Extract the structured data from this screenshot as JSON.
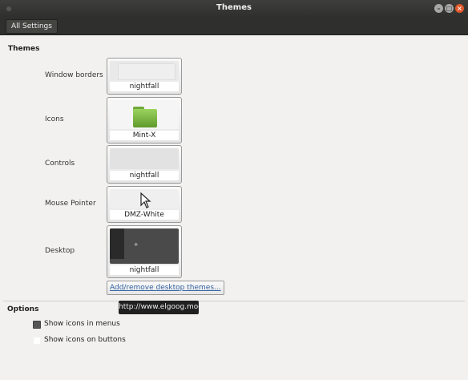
{
  "window": {
    "title": "Themes"
  },
  "toolbar": {
    "all_settings_label": "All Settings"
  },
  "themes_section": {
    "title": "Themes",
    "rows": [
      {
        "label": "Window borders",
        "value": "nightfall",
        "icon": "blank-preview"
      },
      {
        "label": "Icons",
        "value": "Mint-X",
        "icon": "folder-icon"
      },
      {
        "label": "Controls",
        "value": "nightfall",
        "icon": "blank-preview"
      },
      {
        "label": "Mouse Pointer",
        "value": "DMZ-White",
        "icon": "arrow-cursor-icon"
      },
      {
        "label": "Desktop",
        "value": "nightfall",
        "icon": "desktop-preview"
      }
    ],
    "add_remove_label": "Add/remove desktop themes..."
  },
  "tooltip": {
    "text": "http://www.elgoog.moc"
  },
  "options_section": {
    "title": "Options",
    "show_icons_in_menus": {
      "label": "Show icons in menus",
      "checked": true
    },
    "show_icons_on_buttons": {
      "label": "Show icons on buttons",
      "checked": false
    }
  },
  "colors": {
    "titlebar": "#2f2f2d",
    "close_button": "#e0582b",
    "link": "#3465a4",
    "folder_green": "#7fbf45"
  }
}
